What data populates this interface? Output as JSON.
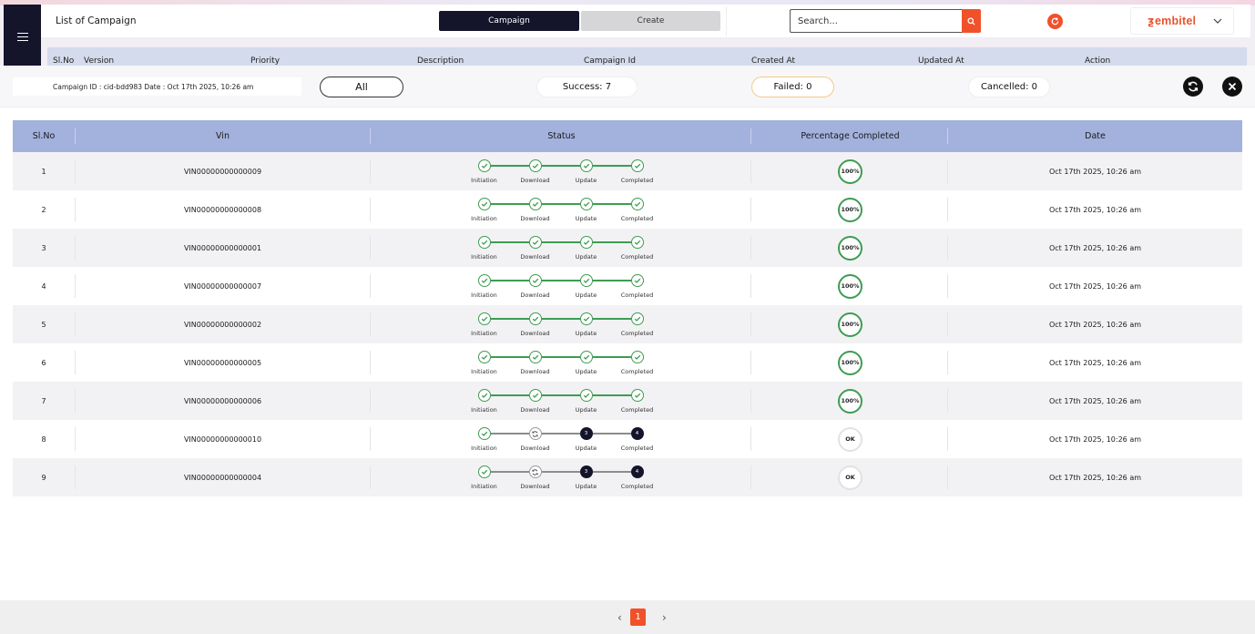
{
  "header": {
    "title": "List of Campaign",
    "tabs": [
      {
        "label": "Campaign",
        "active": true
      },
      {
        "label": "Create",
        "active": false
      }
    ],
    "search_placeholder": "Search...",
    "brand": "embitel",
    "accent_color": "#f0512b"
  },
  "background_table": {
    "columns": [
      "Sl.No",
      "Version",
      "Priority",
      "Description",
      "Campaign Id",
      "Created At",
      "Updated At",
      "Action"
    ]
  },
  "overlay": {
    "campaign_info": "Campaign ID : cid-bdd983 Date : Oct 17th 2025, 10:26 am",
    "filters": {
      "all": "All",
      "success": "Success: 7",
      "failed": "Failed: 0",
      "cancelled": "Cancelled: 0"
    },
    "table": {
      "columns": [
        "Sl.No",
        "Vin",
        "Status",
        "Percentage Completed",
        "Date"
      ],
      "step_labels": [
        "Initiation",
        "Download",
        "Update",
        "Completed"
      ],
      "rows": [
        {
          "slno": "1",
          "vin": "VIN00000000000009",
          "steps": [
            "done",
            "done",
            "done",
            "done"
          ],
          "pct": "100%",
          "pct_state": "full",
          "date": "Oct 17th 2025, 10:26 am"
        },
        {
          "slno": "2",
          "vin": "VIN00000000000008",
          "steps": [
            "done",
            "done",
            "done",
            "done"
          ],
          "pct": "100%",
          "pct_state": "full",
          "date": "Oct 17th 2025, 10:26 am"
        },
        {
          "slno": "3",
          "vin": "VIN00000000000001",
          "steps": [
            "done",
            "done",
            "done",
            "done"
          ],
          "pct": "100%",
          "pct_state": "full",
          "date": "Oct 17th 2025, 10:26 am"
        },
        {
          "slno": "4",
          "vin": "VIN00000000000007",
          "steps": [
            "done",
            "done",
            "done",
            "done"
          ],
          "pct": "100%",
          "pct_state": "full",
          "date": "Oct 17th 2025, 10:26 am"
        },
        {
          "slno": "5",
          "vin": "VIN00000000000002",
          "steps": [
            "done",
            "done",
            "done",
            "done"
          ],
          "pct": "100%",
          "pct_state": "full",
          "date": "Oct 17th 2025, 10:26 am"
        },
        {
          "slno": "6",
          "vin": "VIN00000000000005",
          "steps": [
            "done",
            "done",
            "done",
            "done"
          ],
          "pct": "100%",
          "pct_state": "full",
          "date": "Oct 17th 2025, 10:26 am"
        },
        {
          "slno": "7",
          "vin": "VIN00000000000006",
          "steps": [
            "done",
            "done",
            "done",
            "done"
          ],
          "pct": "100%",
          "pct_state": "full",
          "date": "Oct 17th 2025, 10:26 am"
        },
        {
          "slno": "8",
          "vin": "VIN00000000000010",
          "steps": [
            "done",
            "progress",
            "3",
            "4"
          ],
          "pct": "OK",
          "pct_state": "zero",
          "date": "Oct 17th 2025, 10:26 am"
        },
        {
          "slno": "9",
          "vin": "VIN00000000000004",
          "steps": [
            "done",
            "progress",
            "3",
            "4"
          ],
          "pct": "OK",
          "pct_state": "zero",
          "date": "Oct 17th 2025, 10:26 am"
        }
      ]
    }
  },
  "pagination": {
    "current": "1",
    "prev_icon": "chevron-left-icon",
    "next_icon": "chevron-right-icon"
  }
}
